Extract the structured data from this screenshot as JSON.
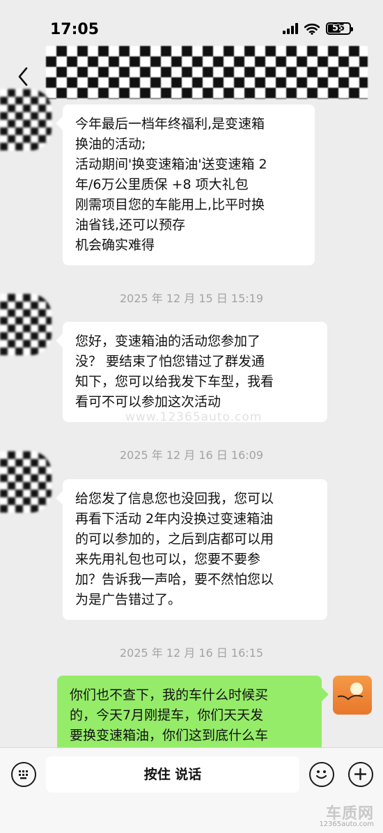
{
  "status_bar": {
    "time": "17:05",
    "battery": "55"
  },
  "messages": [
    {
      "from": "other",
      "lines": [
        "今年最后一档年终福利,是变速箱",
        "换油的活动;",
        "活动期间'换变速箱油'送变速箱 2",
        "年/6万公里质保 +8 项大礼包",
        "刚需项目您的车能用上,比平时换",
        "油省钱,还可以预存",
        "机会确实难得"
      ]
    },
    {
      "timestamp": "2025 年 12 月 15 日  15:19"
    },
    {
      "from": "other",
      "lines": [
        "您好，变速箱油的活动您参加了",
        "没？ 要结束了怕您错过了群发通",
        "知下，您可以给我发下车型，我看",
        "看可不可以参加这次活动"
      ]
    },
    {
      "timestamp": "2025 年 12 月 16 日  16:09"
    },
    {
      "from": "other",
      "lines": [
        "给您发了信息您也没回我，您可以",
        "再看下活动 2年内没换过变速箱油",
        "的可以参加的，之后到店都可以用",
        "来先用礼包也可以，您要不要参",
        "加？告诉我一声哈，要不然怕您以",
        "为是广告错过了。"
      ]
    },
    {
      "timestamp": "2025 年 12 月 16 日  16:15"
    },
    {
      "from": "me",
      "lines": [
        "你们也不查下，我的车什么时候买",
        "的，今天7月刚提车，你们天天发",
        "要换变速箱油，你们这到底什么车"
      ]
    }
  ],
  "watermark": "www.12365auto.com",
  "input_bar": {
    "hold_to_talk": "按住 说话"
  },
  "brand": {
    "name": "车质网",
    "url": "12365auto.com"
  },
  "icons": {
    "back": "chevron-left-icon",
    "keyboard": "keyboard-icon",
    "emoji": "emoji-icon",
    "plus": "plus-icon"
  }
}
